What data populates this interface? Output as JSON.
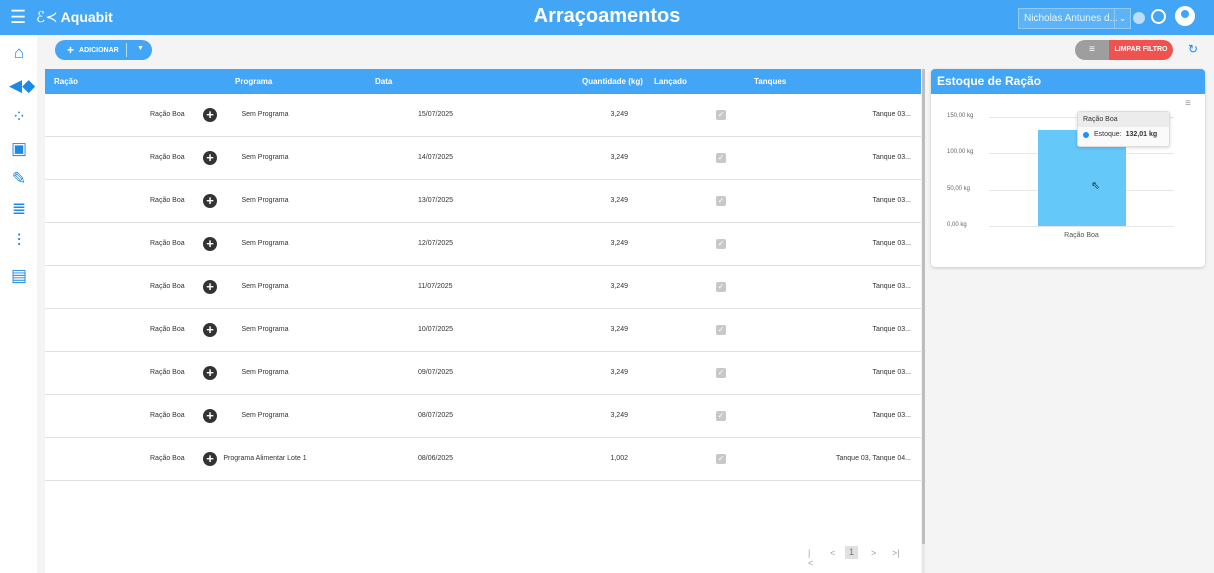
{
  "header": {
    "menu_icon": "hamburger-icon",
    "logo_text": "Aquabit",
    "title": "Arraçoamentos",
    "user": "Nicholas Antunes d...",
    "colors": {
      "primary": "#42a5f5",
      "danger": "#ef5350"
    }
  },
  "sidebar": {
    "items": [
      {
        "icon": "farm-icon"
      },
      {
        "icon": "fish-icon"
      },
      {
        "icon": "cells-icon"
      },
      {
        "icon": "warehouse-icon"
      },
      {
        "icon": "feeding-icon"
      },
      {
        "icon": "database-icon"
      },
      {
        "icon": "thermometer-icon"
      },
      {
        "icon": "report-icon"
      }
    ]
  },
  "toolbar": {
    "add_label": "ADICIONAR",
    "clear_filter_label": "LIMPAR FILTRO"
  },
  "table": {
    "columns": [
      "Ração",
      "Programa",
      "Data",
      "Quantidade (kg)",
      "Lançado",
      "Tanques"
    ],
    "rows": [
      {
        "racao": "Ração Boa",
        "programa": "Sem Programa",
        "data": "15/07/2025",
        "quantidade": "3,249",
        "lancado": true,
        "tanques": "Tanque 03..."
      },
      {
        "racao": "Ração Boa",
        "programa": "Sem Programa",
        "data": "14/07/2025",
        "quantidade": "3,249",
        "lancado": true,
        "tanques": "Tanque 03..."
      },
      {
        "racao": "Ração Boa",
        "programa": "Sem Programa",
        "data": "13/07/2025",
        "quantidade": "3,249",
        "lancado": true,
        "tanques": "Tanque 03..."
      },
      {
        "racao": "Ração Boa",
        "programa": "Sem Programa",
        "data": "12/07/2025",
        "quantidade": "3,249",
        "lancado": true,
        "tanques": "Tanque 03..."
      },
      {
        "racao": "Ração Boa",
        "programa": "Sem Programa",
        "data": "11/07/2025",
        "quantidade": "3,249",
        "lancado": true,
        "tanques": "Tanque 03..."
      },
      {
        "racao": "Ração Boa",
        "programa": "Sem Programa",
        "data": "10/07/2025",
        "quantidade": "3,249",
        "lancado": true,
        "tanques": "Tanque 03..."
      },
      {
        "racao": "Ração Boa",
        "programa": "Sem Programa",
        "data": "09/07/2025",
        "quantidade": "3,249",
        "lancado": true,
        "tanques": "Tanque 03..."
      },
      {
        "racao": "Ração Boa",
        "programa": "Sem Programa",
        "data": "08/07/2025",
        "quantidade": "3,249",
        "lancado": true,
        "tanques": "Tanque 03..."
      },
      {
        "racao": "Ração Boa",
        "programa": "Programa Alimentar Lote 1",
        "data": "08/06/2025",
        "quantidade": "1,002",
        "lancado": true,
        "tanques": "Tanque 03, Tanque 04..."
      }
    ]
  },
  "pagination": {
    "current_page": "1"
  },
  "stock": {
    "title": "Estoque de Ração",
    "tooltip_title": "Ração Boa",
    "tooltip_label": "Estoque:",
    "tooltip_value": "132,01 kg"
  },
  "chart_data": {
    "type": "bar",
    "title": "Estoque de Ração",
    "categories": [
      "Ração Boa"
    ],
    "series": [
      {
        "name": "Estoque",
        "values": [
          132.01
        ]
      }
    ],
    "ylim": [
      0,
      150
    ],
    "yticks": [
      "0,00 kg",
      "50,00 kg",
      "100,00 kg",
      "150,00 kg"
    ],
    "ytick_values": [
      0,
      50,
      100,
      150
    ],
    "bar_color": "#64c8f8",
    "grid": true
  }
}
